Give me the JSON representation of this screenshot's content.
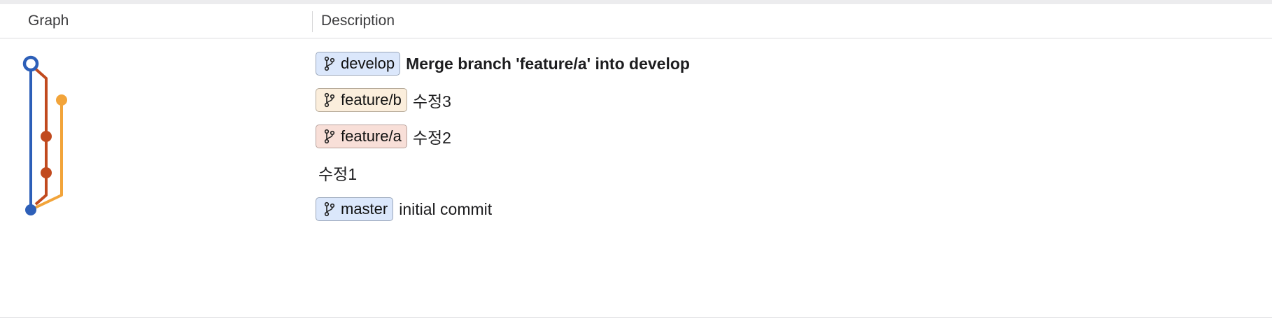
{
  "header": {
    "graph_label": "Graph",
    "description_label": "Description"
  },
  "colors": {
    "develop_line": "#2d5fb8",
    "feature_a_line": "#c14a1e",
    "feature_b_line": "#f2a43a"
  },
  "commits": [
    {
      "branch": "develop",
      "branch_color": "blue",
      "message": "Merge branch 'feature/a' into develop",
      "bold": true
    },
    {
      "branch": "feature/b",
      "branch_color": "cream",
      "message": "수정3",
      "bold": false
    },
    {
      "branch": "feature/a",
      "branch_color": "pink",
      "message": "수정2",
      "bold": false
    },
    {
      "branch": "",
      "branch_color": "",
      "message": "수정1",
      "bold": false
    },
    {
      "branch": "master",
      "branch_color": "blue",
      "message": "initial commit",
      "bold": false
    }
  ],
  "icons": {
    "branch": "git-branch-icon"
  }
}
